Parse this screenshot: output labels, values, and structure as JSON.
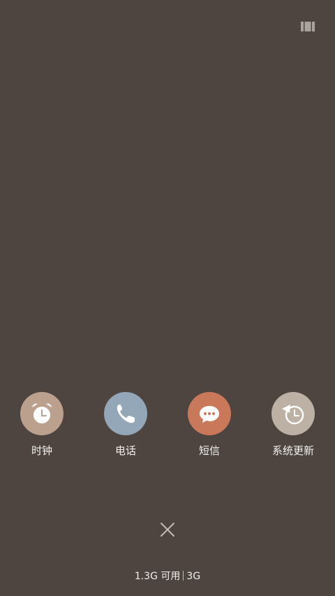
{
  "topbar": {
    "view_toggle_icon": "multi-window-icon"
  },
  "apps": [
    {
      "label": "时钟",
      "icon": "alarm-clock-icon",
      "color": "#bca08e"
    },
    {
      "label": "电话",
      "icon": "phone-icon",
      "color": "#93a7b8"
    },
    {
      "label": "短信",
      "icon": "message-bubble-icon",
      "color": "#c9795a"
    },
    {
      "label": "系统更新",
      "icon": "system-update-icon",
      "color": "#bcb1a4"
    }
  ],
  "close": {
    "icon": "close-icon"
  },
  "memory": {
    "available": "1.3G 可用",
    "total": "3G"
  }
}
